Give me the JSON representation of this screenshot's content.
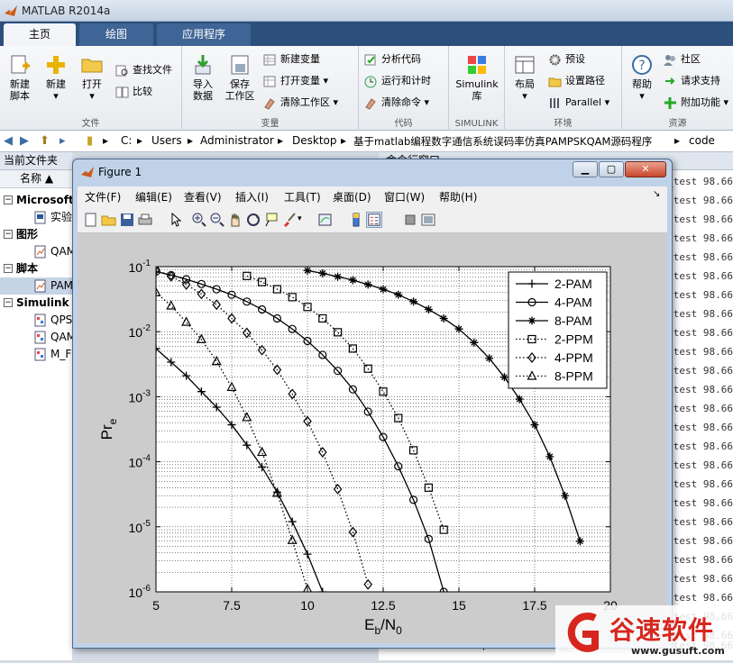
{
  "app": {
    "title": "MATLAB R2014a"
  },
  "tabs": [
    {
      "label": "主页"
    },
    {
      "label": "绘图"
    },
    {
      "label": "应用程序"
    }
  ],
  "ribbon": {
    "file": {
      "label": "文件",
      "new_script": "新建\n脚本",
      "new": "新建",
      "open": "打开",
      "find_files": "查找文件",
      "compare": "比较"
    },
    "variable": {
      "label": "变量",
      "import": "导入\n数据",
      "save_ws": "保存\n工作区",
      "new_var": "新建变量",
      "open_var": "打开变量",
      "clear_ws": "清除工作区"
    },
    "code": {
      "label": "代码",
      "analyze": "分析代码",
      "run_time": "运行和计时",
      "clear_cmd": "清除命令"
    },
    "simulink": {
      "label": "SIMULINK",
      "lib": "Simulink\n库"
    },
    "env": {
      "label": "环境",
      "layout": "布局",
      "prefs": "预设",
      "set_path": "设置路径",
      "parallel": "Parallel"
    },
    "resources": {
      "label": "资源",
      "help": "帮助",
      "community": "社区",
      "support": "请求支持",
      "addons": "附加功能"
    }
  },
  "address": {
    "crumbs": [
      "C:",
      "Users",
      "Administrator",
      "Desktop",
      "基于matlab编程数字通信系统误码率仿真PAMPSKQAM源码程序",
      "code"
    ]
  },
  "file_panel": {
    "title": "当前文件夹",
    "name_header": "名称",
    "rows": [
      {
        "type": "grp",
        "label": "Microsoft"
      },
      {
        "type": "itm",
        "label": "实验"
      },
      {
        "type": "grp",
        "label": "图形"
      },
      {
        "type": "itm",
        "label": "QAM"
      },
      {
        "type": "grp",
        "label": "脚本"
      },
      {
        "type": "itm",
        "label": "PAM"
      },
      {
        "type": "grp",
        "label": "Simulink"
      },
      {
        "type": "itm",
        "label": "QPS"
      },
      {
        "type": "itm",
        "label": "QAM"
      },
      {
        "type": "itm",
        "label": "M_F"
      }
    ]
  },
  "command_window": {
    "title": "命令行窗口",
    "lines": [
      "epoch 725   recog_train    recog_test   98.66",
      "test 98.66",
      "test 98.66",
      "test 98.66",
      "test 98.66",
      "test 98.66",
      "test 98.66",
      "test 98.66",
      "test 98.66",
      "test 98.66",
      "test 98.66",
      "test 98.66",
      "test 98.66",
      "test 98.66",
      "test 98.66",
      "test 98.66",
      "test 98.66",
      "test 98.66",
      "test 98.66",
      "test 98.66",
      "test 98.66",
      "test 98.66",
      "test 98.66",
      "test 98.66",
      "test 98.66",
      "epoch 875   recog_train  79.3  recog_test  98.66"
    ]
  },
  "figure": {
    "title": "Figure 1",
    "menu": [
      "文件(F)",
      "编辑(E)",
      "查看(V)",
      "插入(I)",
      "工具(T)",
      "桌面(D)",
      "窗口(W)",
      "帮助(H)"
    ],
    "window_buttons": {
      "minimize": "▁",
      "maximize": "▢",
      "close": "✕"
    }
  },
  "chart_data": {
    "type": "line",
    "title": "",
    "xlabel": "Eb/N0",
    "ylabel": "Pre",
    "xlim": [
      5,
      20
    ],
    "ylim": [
      1e-06,
      0.1
    ],
    "yscale": "log",
    "grid": true,
    "legend_position": "top-right",
    "x_ticks": [
      5,
      7.5,
      10,
      12.5,
      15,
      17.5,
      20
    ],
    "x_tick_labels": [
      "5",
      "7.5",
      "10",
      "12.5",
      "15",
      "17.5",
      "20"
    ],
    "y_ticks": [
      1e-06,
      1e-05,
      0.0001,
      0.001,
      0.01,
      0.1
    ],
    "y_tick_labels": [
      "-6",
      "-5",
      "-4",
      "-3",
      "-2",
      "-1"
    ],
    "y_tick_base": "10",
    "series": [
      {
        "name": "2-PAM",
        "style": "solid",
        "marker": "plus",
        "x": [
          5,
          5.5,
          6,
          6.5,
          7,
          7.5,
          8,
          8.5,
          9,
          9.5,
          10,
          10.5
        ],
        "y": [
          0.0055,
          0.0034,
          0.0021,
          0.0012,
          0.00069,
          0.00037,
          0.00018,
          8.3e-05,
          3.4e-05,
          1.2e-05,
          3.8e-06,
          1e-06
        ]
      },
      {
        "name": "4-PAM",
        "style": "solid",
        "marker": "circle",
        "x": [
          5,
          5.5,
          6,
          6.5,
          7,
          7.5,
          8,
          8.5,
          9,
          9.5,
          10,
          10.5,
          11,
          11.5,
          12,
          12.5,
          13,
          13.5,
          14,
          14.5
        ],
        "y": [
          0.084,
          0.074,
          0.064,
          0.054,
          0.045,
          0.037,
          0.029,
          0.022,
          0.016,
          0.011,
          0.0072,
          0.0044,
          0.0025,
          0.0013,
          0.00059,
          0.00024,
          8.5e-05,
          2.6e-05,
          6.5e-06,
          1e-06
        ]
      },
      {
        "name": "8-PAM",
        "style": "solid",
        "marker": "dot",
        "x": [
          10,
          10.5,
          11,
          11.5,
          12,
          12.5,
          13,
          13.5,
          14,
          14.5,
          15,
          15.5,
          16,
          16.5,
          17,
          17.5,
          18,
          18.5,
          19
        ],
        "y": [
          0.087,
          0.079,
          0.07,
          0.062,
          0.053,
          0.045,
          0.037,
          0.029,
          0.022,
          0.016,
          0.011,
          0.0068,
          0.0039,
          0.002,
          0.00092,
          0.00037,
          0.00012,
          3e-05,
          6e-06
        ]
      },
      {
        "name": "2-PPM",
        "style": "dotted",
        "marker": "square",
        "x": [
          8,
          8.5,
          9,
          9.5,
          10,
          10.5,
          11,
          11.5,
          12,
          12.5,
          13,
          13.5,
          14,
          14.5
        ],
        "y": [
          0.072,
          0.058,
          0.045,
          0.034,
          0.024,
          0.016,
          0.0098,
          0.0055,
          0.0027,
          0.0012,
          0.00047,
          0.00015,
          4e-05,
          9e-06
        ]
      },
      {
        "name": "4-PPM",
        "style": "dotted",
        "marker": "diamond",
        "x": [
          5,
          5.5,
          6,
          6.5,
          7,
          7.5,
          8,
          8.5,
          9,
          9.5,
          10,
          10.5,
          11,
          11.5,
          12
        ],
        "y": [
          0.09,
          0.071,
          0.053,
          0.038,
          0.026,
          0.016,
          0.0096,
          0.0052,
          0.0026,
          0.0011,
          0.00042,
          0.00014,
          3.8e-05,
          8.3e-06,
          1.3e-06
        ]
      },
      {
        "name": "8-PPM",
        "style": "dotted",
        "marker": "triangle",
        "x": [
          5,
          5.5,
          6,
          6.5,
          7,
          7.5,
          8,
          8.5,
          9,
          9.5,
          10
        ],
        "y": [
          0.04,
          0.025,
          0.014,
          0.0076,
          0.0035,
          0.0014,
          0.00048,
          0.00014,
          3.3e-05,
          6.2e-06,
          1.1e-06
        ]
      }
    ]
  },
  "watermark": {
    "text": "谷速软件",
    "url": "www.gusuft.com"
  }
}
